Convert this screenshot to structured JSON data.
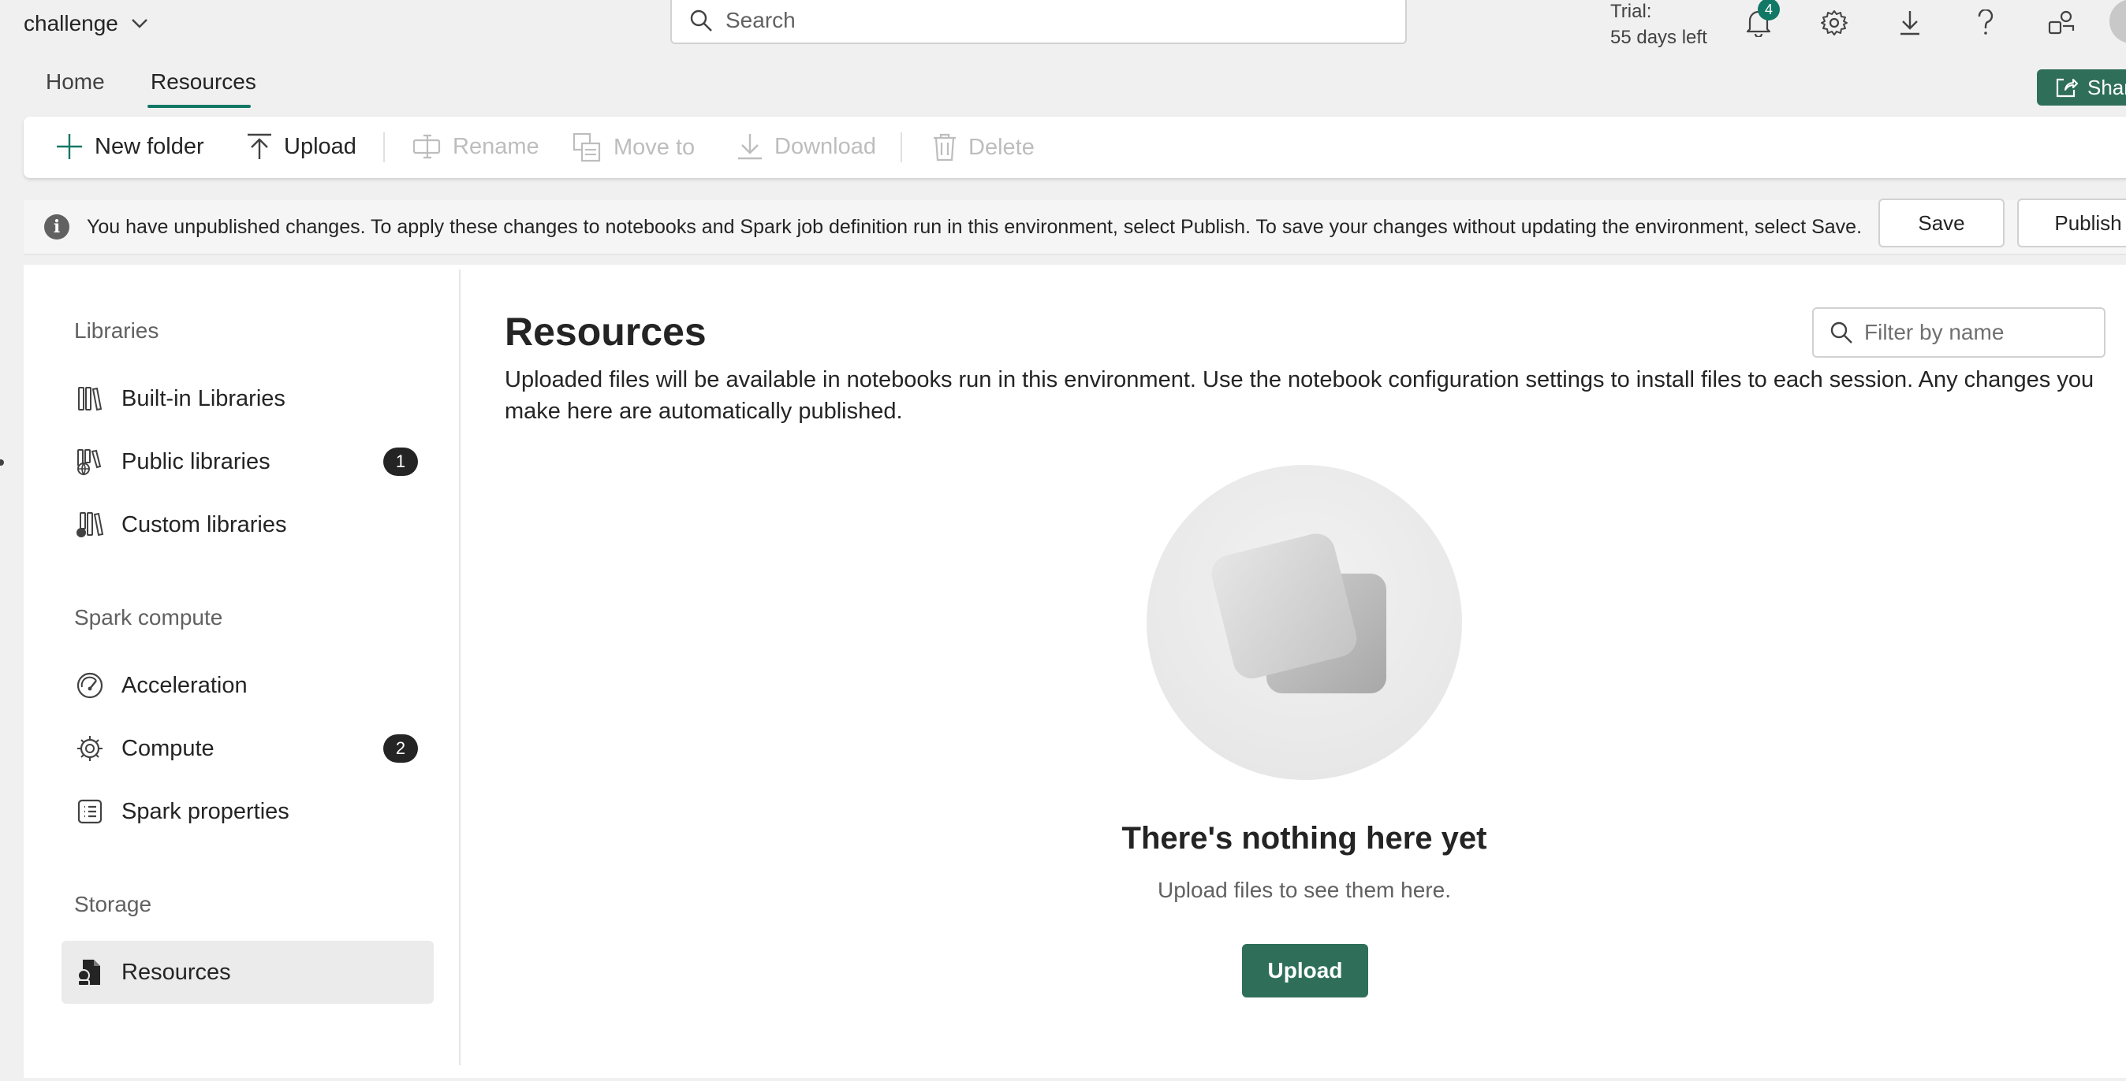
{
  "header": {
    "workspace_name": "challenge",
    "search_placeholder": "Search",
    "trial_label": "Trial:",
    "trial_days": "55 days left",
    "notification_count": "4"
  },
  "tabs": {
    "home": "Home",
    "resources": "Resources",
    "share": "Share"
  },
  "toolbar": {
    "new_folder": "New folder",
    "upload": "Upload",
    "rename": "Rename",
    "move_to": "Move to",
    "download": "Download",
    "delete": "Delete"
  },
  "message_bar": {
    "text": "You have unpublished changes. To apply these changes to notebooks and Spark job definition run in this environment, select Publish. To save your changes without updating the environment, select Save.",
    "save": "Save",
    "publish": "Publish"
  },
  "sidebar": {
    "libraries_header": "Libraries",
    "built_in": "Built-in Libraries",
    "public": "Public libraries",
    "public_badge": "1",
    "custom": "Custom libraries",
    "spark_header": "Spark compute",
    "acceleration": "Acceleration",
    "compute": "Compute",
    "compute_badge": "2",
    "spark_properties": "Spark properties",
    "storage_header": "Storage",
    "resources": "Resources"
  },
  "main": {
    "title": "Resources",
    "description": "Uploaded files will be available in notebooks run in this environment. Use the notebook configuration settings to install files to each session. Any changes you make here are automatically published.",
    "filter_placeholder": "Filter by name",
    "empty_title": "There's nothing here yet",
    "empty_subtitle": "Upload files to see them here.",
    "upload_button": "Upload"
  },
  "colors": {
    "accent": "#117865",
    "primary_button": "#2f6f5a"
  },
  "icons": [
    "chevron-down-icon",
    "search-icon",
    "bell-icon",
    "gear-icon",
    "download-icon",
    "help-icon",
    "people-icon",
    "share-icon",
    "add-icon",
    "upload-icon",
    "rename-icon",
    "move-icon",
    "delete-icon",
    "info-icon",
    "library-icon",
    "globe-library-icon",
    "custom-library-icon",
    "speedometer-icon",
    "chip-icon",
    "list-icon",
    "document-icon"
  ]
}
